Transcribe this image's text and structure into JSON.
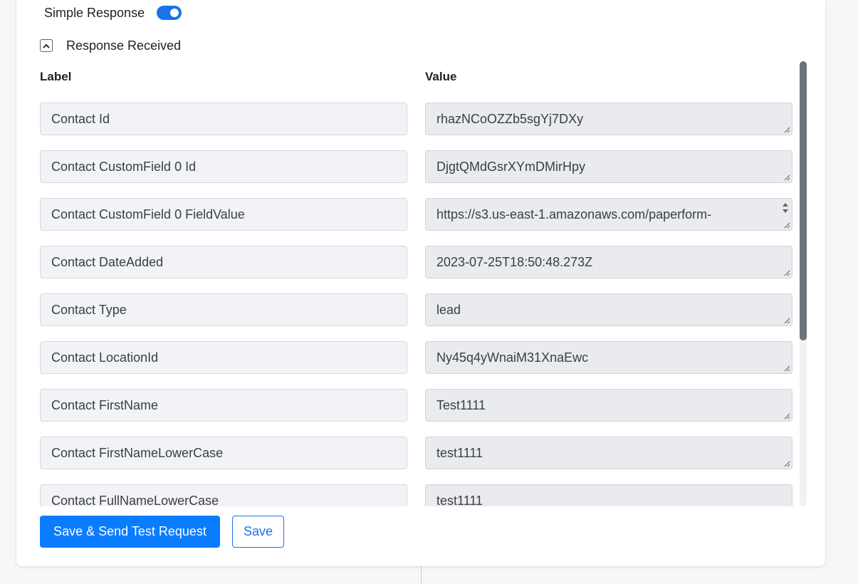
{
  "settings": {
    "simple_response_label": "Simple Response",
    "simple_response_on": true
  },
  "response": {
    "section_label": "Response Received",
    "label_header": "Label",
    "value_header": "Value",
    "rows": [
      {
        "label": "Contact Id",
        "value": "rhazNCoOZZb5sgYj7DXy"
      },
      {
        "label": "Contact CustomField 0 Id",
        "value": "DjgtQMdGsrXYmDMirHpy"
      },
      {
        "label": "Contact CustomField 0 FieldValue",
        "value": "https://s3.us-east-1.amazonaws.com/paperform-"
      },
      {
        "label": "Contact DateAdded",
        "value": "2023-07-25T18:50:48.273Z"
      },
      {
        "label": "Contact Type",
        "value": "lead"
      },
      {
        "label": "Contact LocationId",
        "value": "Ny45q4yWnaiM31XnaEwc"
      },
      {
        "label": "Contact FirstName",
        "value": "Test1111"
      },
      {
        "label": "Contact FirstNameLowerCase",
        "value": "test1111"
      },
      {
        "label": "Contact FullNameLowerCase",
        "value": "test1111"
      }
    ]
  },
  "actions": {
    "save_send_label": "Save & Send Test Request",
    "save_label": "Save"
  },
  "colors": {
    "accent": "#0a7cff",
    "toggle": "#1a73e8"
  }
}
